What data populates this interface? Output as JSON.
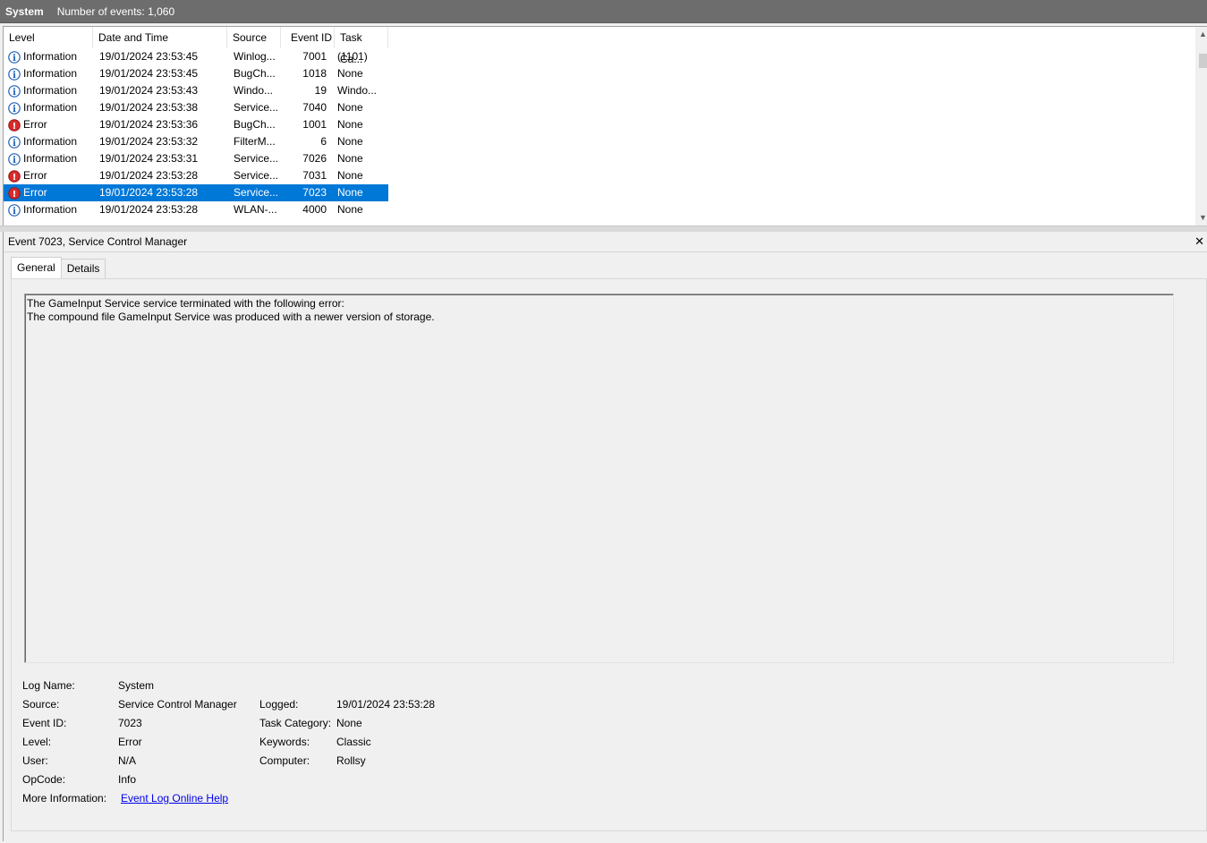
{
  "header": {
    "log_name": "System",
    "event_count": "Number of events: 1,060"
  },
  "columns": [
    "Level",
    "Date and Time",
    "Source",
    "Event ID",
    "Task Ca..."
  ],
  "events": [
    {
      "level": "Information",
      "date": "19/01/2024 23:53:45",
      "source": "Winlog...",
      "id": "7001",
      "task": "(1101)",
      "icon": "info-icon"
    },
    {
      "level": "Information",
      "date": "19/01/2024 23:53:45",
      "source": "BugCh...",
      "id": "1018",
      "task": "None",
      "icon": "info-icon"
    },
    {
      "level": "Information",
      "date": "19/01/2024 23:53:43",
      "source": "Windo...",
      "id": "19",
      "task": "Windo...",
      "icon": "info-icon"
    },
    {
      "level": "Information",
      "date": "19/01/2024 23:53:38",
      "source": "Service...",
      "id": "7040",
      "task": "None",
      "icon": "info-icon"
    },
    {
      "level": "Error",
      "date": "19/01/2024 23:53:36",
      "source": "BugCh...",
      "id": "1001",
      "task": "None",
      "icon": "error-icon"
    },
    {
      "level": "Information",
      "date": "19/01/2024 23:53:32",
      "source": "FilterM...",
      "id": "6",
      "task": "None",
      "icon": "info-icon"
    },
    {
      "level": "Information",
      "date": "19/01/2024 23:53:31",
      "source": "Service...",
      "id": "7026",
      "task": "None",
      "icon": "info-icon"
    },
    {
      "level": "Error",
      "date": "19/01/2024 23:53:28",
      "source": "Service...",
      "id": "7031",
      "task": "None",
      "icon": "error-icon"
    },
    {
      "level": "Error",
      "date": "19/01/2024 23:53:28",
      "source": "Service...",
      "id": "7023",
      "task": "None",
      "icon": "error-icon",
      "selected": true
    },
    {
      "level": "Information",
      "date": "19/01/2024 23:53:28",
      "source": "WLAN-...",
      "id": "4000",
      "task": "None",
      "icon": "info-icon"
    }
  ],
  "detail": {
    "title": "Event 7023, Service Control Manager",
    "tabs": [
      "General",
      "Details"
    ],
    "message_line1": "The GameInput Service service terminated with the following error:",
    "message_line2": "The compound file GameInput Service was produced with a newer version of storage.",
    "left_props": [
      {
        "label": "Log Name:",
        "value": "System"
      },
      {
        "label": "Source:",
        "value": "Service Control Manager"
      },
      {
        "label": "Event ID:",
        "value": "7023"
      },
      {
        "label": "Level:",
        "value": "Error"
      },
      {
        "label": "User:",
        "value": "N/A"
      },
      {
        "label": "OpCode:",
        "value": "Info"
      },
      {
        "label": "More Information:",
        "value": "Event Log Online Help",
        "link": true
      }
    ],
    "right_props": [
      {
        "label": "Logged:",
        "value": "19/01/2024 23:53:28"
      },
      {
        "label": "Task Category:",
        "value": "None"
      },
      {
        "label": "Keywords:",
        "value": "Classic"
      },
      {
        "label": "Computer:",
        "value": "Rollsy"
      }
    ]
  },
  "colors": {
    "selection": "#0078d7",
    "header_bar": "#6d6d6d",
    "error_red": "#d92b2b",
    "info_blue": "#1e5eb8",
    "link": "#0000ee"
  }
}
